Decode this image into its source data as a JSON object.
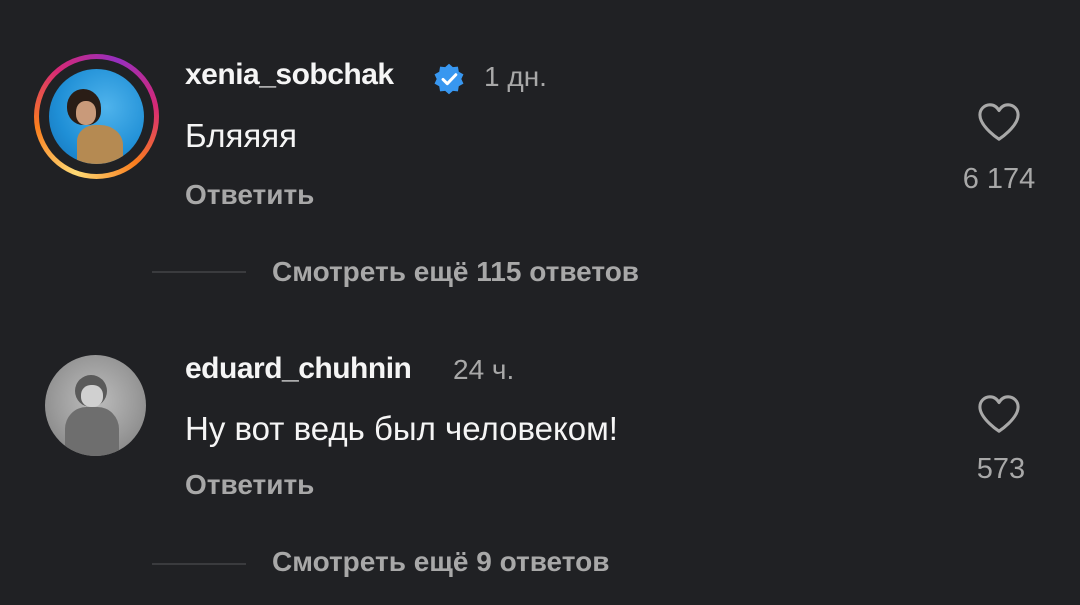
{
  "comments": [
    {
      "username": "xenia_sobchak",
      "verified": true,
      "time": "1 дн.",
      "text": "Бляяяя",
      "reply_label": "Ответить",
      "likes": "6 174",
      "more_replies": "Смотреть ещё 115 ответов",
      "avatar_story_ring": true
    },
    {
      "username": "eduard_chuhnin",
      "verified": false,
      "time": "24 ч.",
      "text": "Ну вот ведь был человеком!",
      "reply_label": "Ответить",
      "likes": "573",
      "more_replies": "Смотреть ещё 9 ответов",
      "avatar_story_ring": false
    }
  ],
  "colors": {
    "background": "#202124",
    "primary_text": "#f5f5f5",
    "secondary_text": "#a8a8a8",
    "verified_badge": "#3897f0"
  }
}
